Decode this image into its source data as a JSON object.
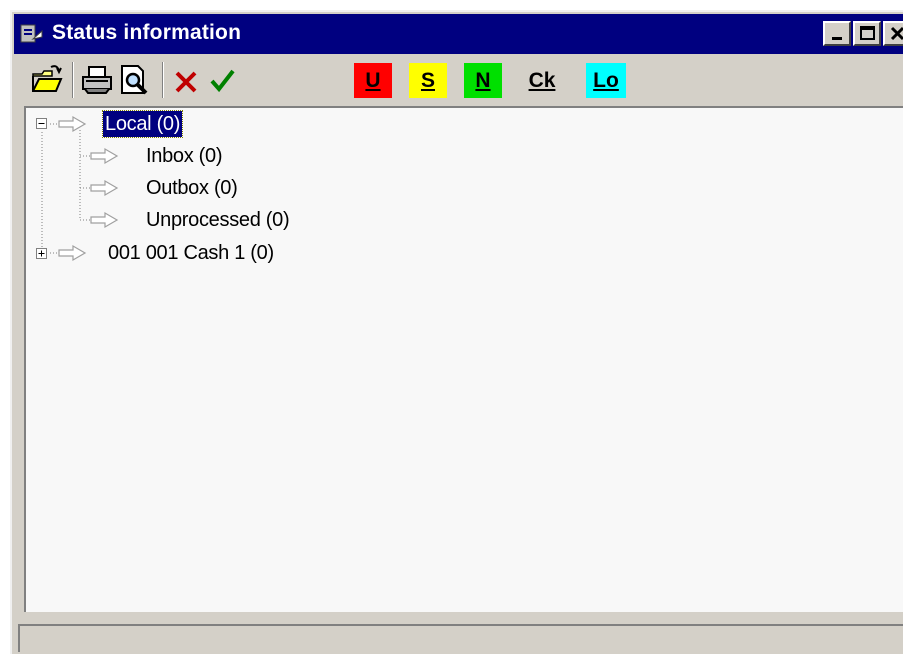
{
  "window": {
    "title": "Status information",
    "title_bar_color": "#000080"
  },
  "title_buttons": {
    "minimize_icon": "minimize-icon",
    "maximize_icon": "maximize-icon",
    "close_icon": "close-icon"
  },
  "toolbar": {
    "icons": [
      "open-folder-icon",
      "print-icon",
      "print-preview-icon",
      "delete-x-icon",
      "confirm-check-icon"
    ],
    "flags": [
      {
        "label": "U",
        "color": "#ff0000"
      },
      {
        "label": "S",
        "color": "#ffff00"
      },
      {
        "label": "N",
        "color": "#00e000"
      },
      {
        "label": "Ck",
        "color": "#d4d0c8"
      },
      {
        "label": "Lo",
        "color": "#00ffff"
      }
    ]
  },
  "tree": {
    "nodes": [
      {
        "label": "Local (0)",
        "expanded": true,
        "selected": true,
        "level": 0
      },
      {
        "label": "Inbox (0)",
        "level": 1
      },
      {
        "label": "Outbox (0)",
        "level": 1
      },
      {
        "label": "Unprocessed (0)",
        "level": 1
      },
      {
        "label": "001 001  Cash 1 (0)",
        "expanded": false,
        "level": 0
      }
    ]
  },
  "statusbar": {
    "text": ""
  }
}
